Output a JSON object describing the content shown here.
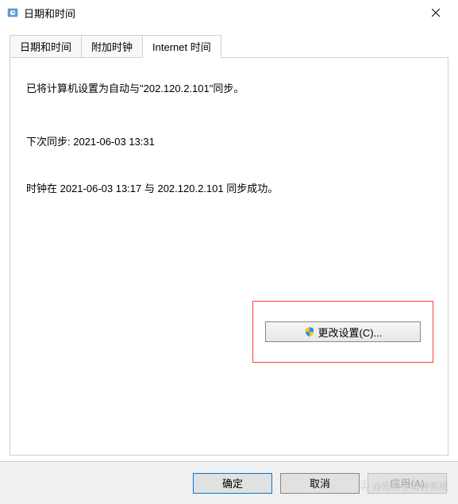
{
  "titlebar": {
    "title": "日期和时间"
  },
  "tabs": {
    "tab1": "日期和时间",
    "tab2": "附加时钟",
    "tab3": "Internet 时间"
  },
  "content": {
    "sync_setup": "已将计算机设置为自动与\"202.120.2.101\"同步。",
    "next_sync": "下次同步: 2021-06-03 13:31",
    "last_sync": "时钟在 2021-06-03 13:17 与 202.120.2.101 同步成功。",
    "change_settings": "更改设置(C)..."
  },
  "buttons": {
    "ok": "确定",
    "cancel": "取消",
    "apply": "应用(A)"
  },
  "watermark": {
    "text": "@宏协子母钟系统"
  }
}
